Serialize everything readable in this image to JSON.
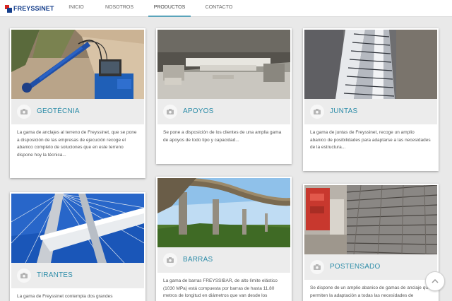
{
  "brand": {
    "name": "FREYSSINET"
  },
  "nav": {
    "items": [
      {
        "label": "INICIO"
      },
      {
        "label": "NOSOTROS"
      },
      {
        "label": "PRODUCTOS"
      },
      {
        "label": "CONTACTO"
      }
    ],
    "active_label": "PRODUCTOS",
    "active_color": "#5aa4bb"
  },
  "theme": {
    "title_color": "#2c8ca8",
    "title_bar_bg": "#ececec",
    "page_bg": "#e9e9e9"
  },
  "cards": [
    {
      "title": "GEOTÉCNIA",
      "icon": "camera-icon",
      "description": "La gama de anclajes al terreno de Freyssinet, que se pone a disposición de las empresas de ejecución recoge el abanico completo de soluciones que en este terreno dispone hoy la técnica..."
    },
    {
      "title": "APOYOS",
      "icon": "camera-icon",
      "description": "Se pone a disposición de los clientes de una amplia gama de apoyos de todo tipo y capacidad..."
    },
    {
      "title": "JUNTAS",
      "icon": "camera-icon",
      "description": "La gama de juntas de Freyssinet, recoge un amplio abanico de posibilidades para adaptarse a las necesidades de la estructura..."
    },
    {
      "title": "TIRANTES",
      "icon": "camera-icon",
      "description": "La gama de Freyssinet contempla dos grandes"
    },
    {
      "title": "BARRAS",
      "icon": "camera-icon",
      "description": "La gama de barras FREYSSIBAR, de alto límite elástico (1030 MPa) está compuesta por barras de hasta 11.80 metros de longitud en diámetros que van desde los"
    },
    {
      "title": "POSTENSADO",
      "icon": "camera-icon",
      "description": "Se dispone de un amplio abanico de gamas de anclaje que permiten la adaptación a todas las necesidades de"
    }
  ],
  "scroll_top": {
    "icon": "chevron-up-icon"
  }
}
